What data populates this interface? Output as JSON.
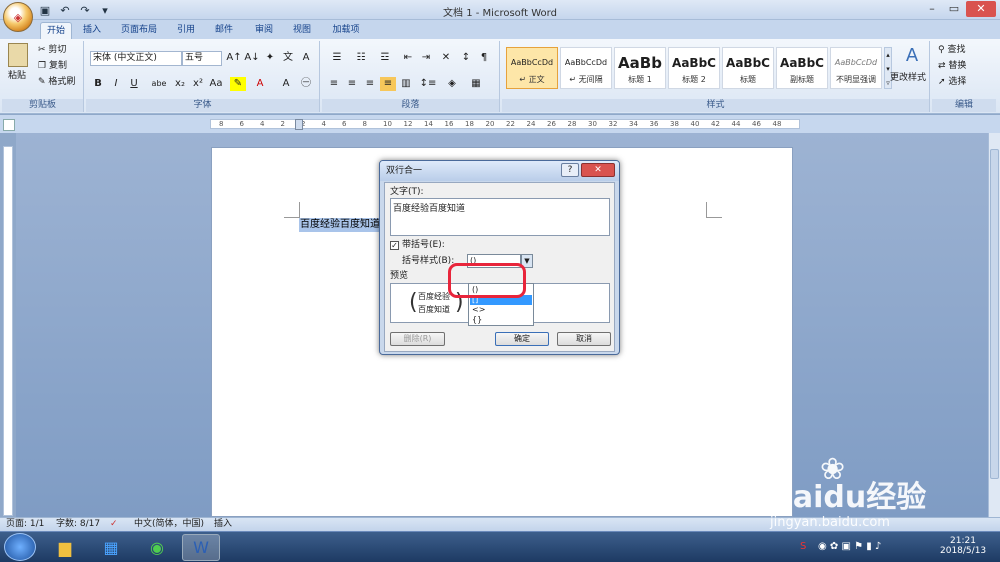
{
  "window": {
    "title": "文档 1 - Microsoft Word"
  },
  "tabs": [
    "开始",
    "插入",
    "页面布局",
    "引用",
    "邮件",
    "审阅",
    "视图",
    "加载项"
  ],
  "clipboard": {
    "paste": "粘贴",
    "cut": "剪切",
    "copy": "复制",
    "format_painter": "格式刷",
    "label": "剪贴板"
  },
  "font": {
    "name": "宋体 (中文正文)",
    "size": "五号",
    "label": "字体",
    "buttons": [
      "B",
      "I",
      "U",
      "abe",
      "x₂",
      "x²",
      "Aa"
    ]
  },
  "paragraph": {
    "label": "段落"
  },
  "styles": {
    "label": "样式",
    "items": [
      {
        "sample": "AaBbCcDd",
        "name": "↵ 正文"
      },
      {
        "sample": "AaBbCcDd",
        "name": "↵ 无间隔"
      },
      {
        "sample": "AaBb",
        "name": "标题 1"
      },
      {
        "sample": "AaBbC",
        "name": "标题 2"
      },
      {
        "sample": "AaBbC",
        "name": "标题"
      },
      {
        "sample": "AaBbC",
        "name": "副标题"
      },
      {
        "sample": "AaBbCcDd",
        "name": "不明显强调"
      }
    ],
    "change": "更改样式"
  },
  "editing": {
    "find": "查找",
    "replace": "替换",
    "select": "选择",
    "label": "编辑"
  },
  "ruler": {
    "ticks": [
      "8",
      "6",
      "4",
      "2",
      "2",
      "4",
      "6",
      "8",
      "10",
      "12",
      "14",
      "16",
      "18",
      "20",
      "22",
      "24",
      "26",
      "28",
      "30",
      "32",
      "34",
      "36",
      "38",
      "40",
      "42",
      "44",
      "46",
      "48"
    ]
  },
  "document": {
    "selected_text": "百度经验百度知道"
  },
  "dialog": {
    "title": "双行合一",
    "text_label": "文字(T):",
    "text_value": "百度经验百度知道",
    "bracket_checkbox": "带括号(E):",
    "bracket_style_label": "括号样式(B):",
    "bracket_style_value": "()",
    "options": [
      "()",
      "[]",
      "<>",
      "{}"
    ],
    "preview_label": "预览",
    "preview_line1": "百度经验",
    "preview_line2": "百度知道",
    "delete_btn": "删除(R)",
    "ok_btn": "确定",
    "cancel_btn": "取消"
  },
  "status": {
    "page": "页面: 1/1",
    "words": "字数: 8/17",
    "lang": "中文(简体，中国)",
    "mode": "插入"
  },
  "watermark": {
    "brand": "Baidu经验",
    "url": "jingyan.baidu.com"
  },
  "taskbar": {
    "time": "21:21",
    "date": "2018/5/13"
  }
}
